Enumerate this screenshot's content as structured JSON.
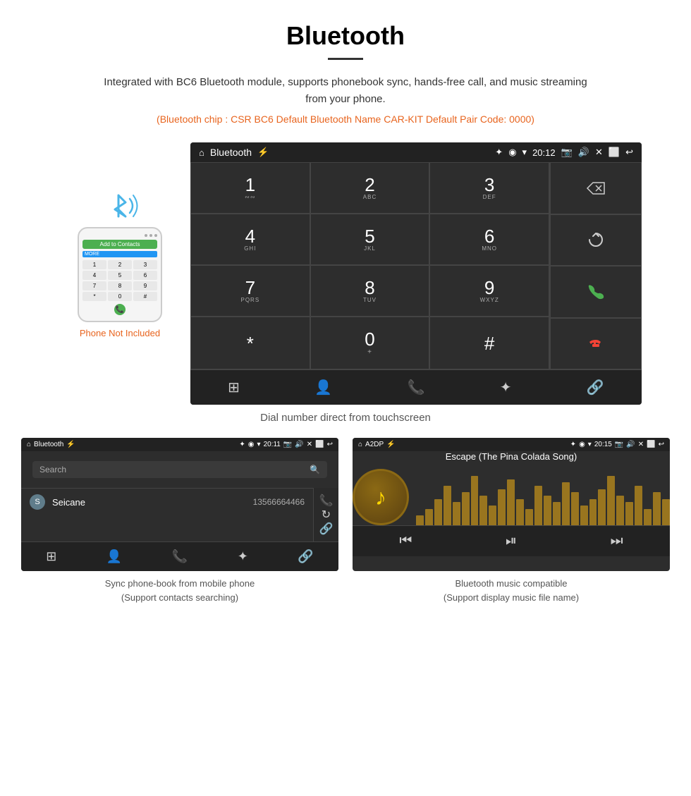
{
  "page": {
    "title": "Bluetooth",
    "divider": true,
    "description": "Integrated with BC6 Bluetooth module, supports phonebook sync, hands-free call, and music streaming from your phone.",
    "specs": "(Bluetooth chip : CSR BC6   Default Bluetooth Name CAR-KIT    Default Pair Code: 0000)",
    "main_caption": "Dial number direct from touchscreen",
    "bottom_left_caption": "Sync phone-book from mobile phone\n(Support contacts searching)",
    "bottom_right_caption": "Bluetooth music compatible\n(Support display music file name)"
  },
  "dial_screen": {
    "status": {
      "home_icon": "⌂",
      "title": "Bluetooth",
      "usb_icon": "⚡",
      "bt_icon": "✦",
      "location_icon": "◉",
      "wifi_icon": "▾",
      "time": "20:12",
      "camera_icon": "📷",
      "volume_icon": "🔊",
      "x_icon": "✕",
      "window_icon": "⬜",
      "back_icon": "↩"
    },
    "keys": [
      {
        "num": "1",
        "sub": "∾∾"
      },
      {
        "num": "2",
        "sub": "ABC"
      },
      {
        "num": "3",
        "sub": "DEF"
      },
      {
        "num": "4",
        "sub": "GHI"
      },
      {
        "num": "5",
        "sub": "JKL"
      },
      {
        "num": "6",
        "sub": "MNO"
      },
      {
        "num": "7",
        "sub": "PQRS"
      },
      {
        "num": "8",
        "sub": "TUV"
      },
      {
        "num": "9",
        "sub": "WXYZ"
      },
      {
        "num": "*",
        "sub": ""
      },
      {
        "num": "0",
        "sub": "+"
      },
      {
        "num": "#",
        "sub": ""
      }
    ],
    "right_panel": [
      "⌫",
      "↻",
      "📞",
      "📞"
    ],
    "bottom_icons": [
      "⊞",
      "👤",
      "📞",
      "✦",
      "🔗"
    ]
  },
  "phonebook_screen": {
    "status_title": "Bluetooth",
    "status_time": "20:11",
    "search_placeholder": "Search",
    "contacts": [
      {
        "letter": "S",
        "name": "Seicane",
        "number": "13566664466"
      }
    ],
    "right_icons": [
      "📞",
      "↻",
      "🔗"
    ],
    "bottom_icons": [
      "⊞",
      "👤",
      "📞",
      "✦",
      "🔗"
    ]
  },
  "music_screen": {
    "status_title": "A2DP",
    "status_time": "20:15",
    "song_title": "Escape (The Pina Colada Song)",
    "note_icon": "♪",
    "controls": [
      "⏮",
      "⏯",
      "⏭"
    ],
    "visualizer_bars": [
      3,
      5,
      8,
      12,
      7,
      10,
      15,
      9,
      6,
      11,
      14,
      8,
      5,
      12,
      9,
      7,
      13,
      10,
      6,
      8,
      11,
      15,
      9,
      7,
      12,
      5,
      10,
      8
    ]
  },
  "phone_mockup": {
    "not_included_text": "Phone Not Included",
    "green_bar_text": "Add to Contacts",
    "blue_bar_text": "MORE",
    "keys": [
      "1",
      "2",
      "3",
      "4",
      "5",
      "6",
      "7",
      "8",
      "*",
      "0",
      "#"
    ]
  },
  "colors": {
    "orange": "#e8641e",
    "green": "#4caf50",
    "red": "#f44336",
    "bt_blue": "#4ab5e8"
  }
}
